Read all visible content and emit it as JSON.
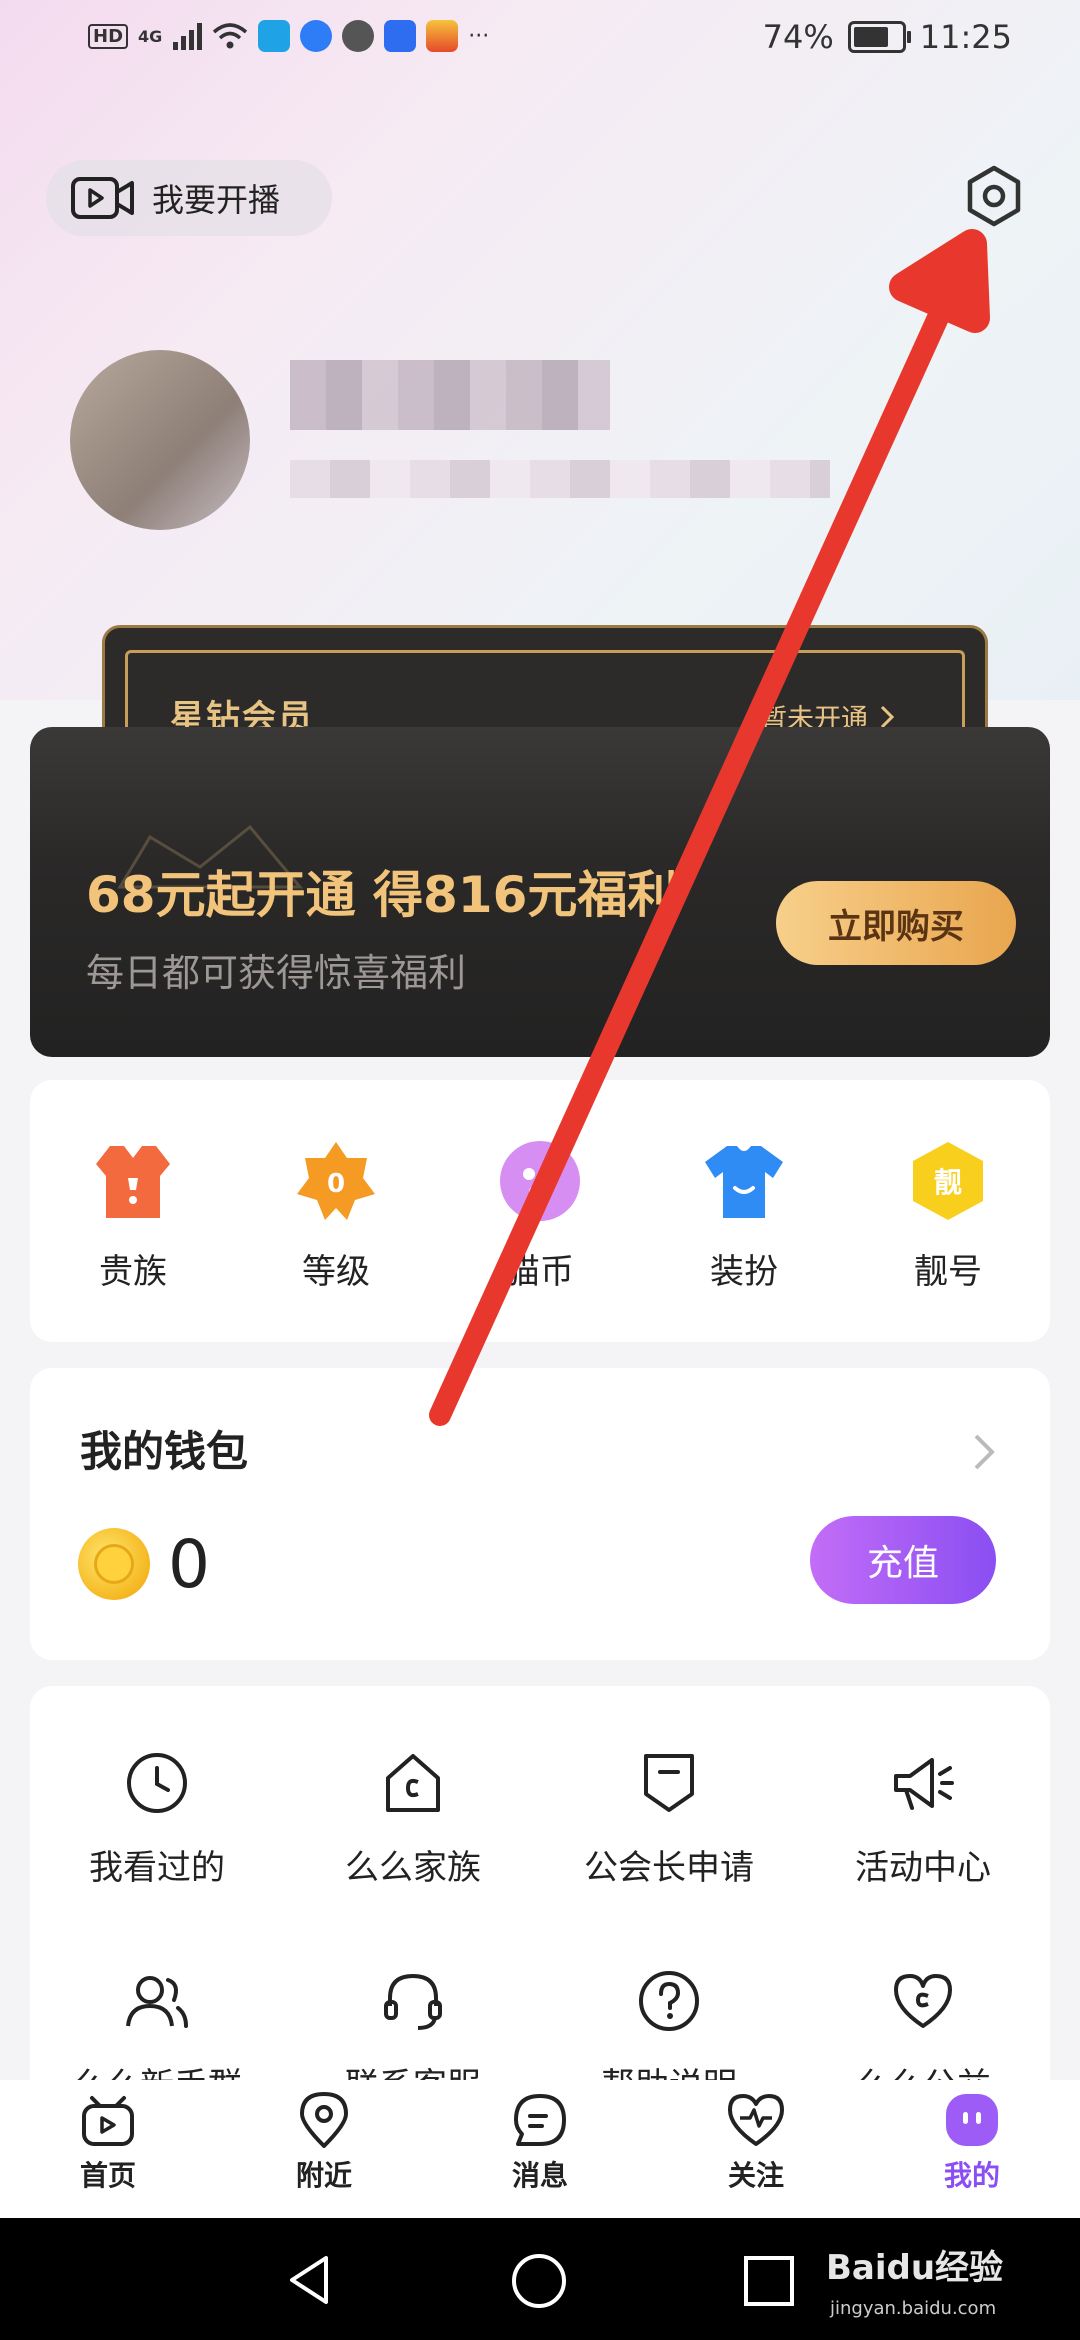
{
  "status_bar": {
    "hd": "HD",
    "network": "4G",
    "battery": "74%",
    "time": "11:25",
    "more": "···"
  },
  "header": {
    "live_label": "我要开播"
  },
  "vip": {
    "title": "星钻会员",
    "status": "暂未开通",
    "promo": "68元起开通 得816元福利",
    "subtitle": "每日都可获得惊喜福利",
    "buy_label": "立即购买"
  },
  "quick_items": [
    "贵族",
    "等级",
    "猫币",
    "装扮",
    "靓号"
  ],
  "quick_badges": {
    "level": "0",
    "pretty_number": "靓"
  },
  "wallet": {
    "title": "我的钱包",
    "balance": "0",
    "recharge_label": "充值"
  },
  "grid_items": [
    {
      "label": "我看过的",
      "icon": "history-clock-icon"
    },
    {
      "label": "么么家族",
      "icon": "family-home-icon"
    },
    {
      "label": "公会长申请",
      "icon": "guild-badge-icon"
    },
    {
      "label": "活动中心",
      "icon": "megaphone-icon"
    },
    {
      "label": "么么新手群",
      "icon": "group-users-icon"
    },
    {
      "label": "联系客服",
      "icon": "headset-icon"
    },
    {
      "label": "帮助说明",
      "icon": "help-question-icon"
    },
    {
      "label": "么么公益",
      "icon": "charity-heart-icon"
    }
  ],
  "nav": [
    {
      "label": "首页",
      "icon": "home-tv-icon"
    },
    {
      "label": "附近",
      "icon": "location-pin-icon"
    },
    {
      "label": "消息",
      "icon": "message-bubble-icon"
    },
    {
      "label": "关注",
      "icon": "heart-pulse-icon"
    },
    {
      "label": "我的",
      "icon": "profile-face-icon"
    }
  ],
  "colors": {
    "accent_purple": "#8a4ef2",
    "gold": "#f2c37a",
    "annotation_red": "#e8382e"
  },
  "watermark": {
    "brand": "Baidu经验",
    "url": "jingyan.baidu.com"
  }
}
